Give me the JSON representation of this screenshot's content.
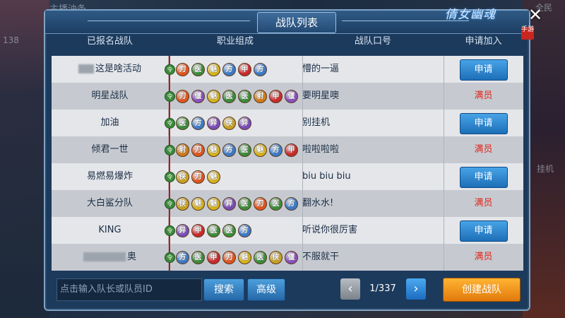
{
  "background": {
    "top_left_text": "主播油条",
    "left_number": "138",
    "right_top_text": "全民",
    "right_mid_text": "挂机"
  },
  "logo": {
    "text": "倩女幽魂",
    "sub": "手游"
  },
  "panel": {
    "title": "战队列表"
  },
  "columns": [
    "已报名战队",
    "职业组成",
    "战队口号",
    "申请加入"
  ],
  "colors": {
    "panel_bg": "#1c3a5c",
    "row_light": "#e4e6ea",
    "row_dark": "#c6cad0",
    "apply_blue": "#2a86d0",
    "full_red": "#e0281c",
    "create_orange": "#f29a1f"
  },
  "class_colors": {
    "刀": "#e0541d",
    "医": "#3a8c3a",
    "魅": "#d6b21a",
    "方": "#3b7ac9",
    "甲": "#c92a2a",
    "偃": "#8a4fc0",
    "射": "#d07a18",
    "异": "#7a4ab8",
    "侠": "#c8a020"
  },
  "rows": [
    {
      "name_masked": true,
      "name": "这是啥活动",
      "jobs": [
        "刀",
        "医",
        "魅",
        "方",
        "甲",
        "方"
      ],
      "slogan": "懵的一逼",
      "action": "申请",
      "status": "apply"
    },
    {
      "name_masked": false,
      "name": "明星战队",
      "jobs": [
        "刀",
        "偃",
        "魅",
        "医",
        "医",
        "射",
        "甲",
        "偃"
      ],
      "slogan": "要明星噢",
      "action": "满员",
      "status": "full"
    },
    {
      "name_masked": false,
      "name": "加油",
      "jobs": [
        "医",
        "方",
        "异",
        "侠",
        "异"
      ],
      "slogan": "别挂机",
      "action": "申请",
      "status": "apply"
    },
    {
      "name_masked": false,
      "name": "倾君一世",
      "jobs": [
        "射",
        "刀",
        "魅",
        "方",
        "医",
        "魅",
        "方",
        "甲"
      ],
      "slogan": "啦啦啦啦",
      "action": "满员",
      "status": "full"
    },
    {
      "name_masked": false,
      "name": "易燃易爆炸",
      "jobs": [
        "侠",
        "刀",
        "魅"
      ],
      "slogan": "biu biu biu",
      "action": "申请",
      "status": "apply"
    },
    {
      "name_masked": false,
      "name": "大白鲨分队",
      "jobs": [
        "侠",
        "魅",
        "魅",
        "异",
        "医",
        "刀",
        "医",
        "方"
      ],
      "slogan": "翻水水!",
      "action": "满员",
      "status": "full"
    },
    {
      "name_masked": false,
      "name": "KING",
      "jobs": [
        "异",
        "甲",
        "医",
        "医",
        "方"
      ],
      "slogan": "听说你很厉害",
      "action": "申请",
      "status": "apply"
    },
    {
      "name_masked": true,
      "name": "奥",
      "jobs": [
        "方",
        "医",
        "甲",
        "刀",
        "魅",
        "医",
        "侠",
        "偃"
      ],
      "slogan": "不服就干",
      "action": "满员",
      "status": "full"
    }
  ],
  "footer": {
    "search_placeholder": "点击输入队长或队员ID",
    "search_btn": "搜索",
    "advanced_btn": "高级",
    "page": "1/337",
    "create_btn": "创建战队"
  },
  "lead_icon_text": "令",
  "close_icon": "✕",
  "prev_icon": "‹",
  "next_icon": "›"
}
